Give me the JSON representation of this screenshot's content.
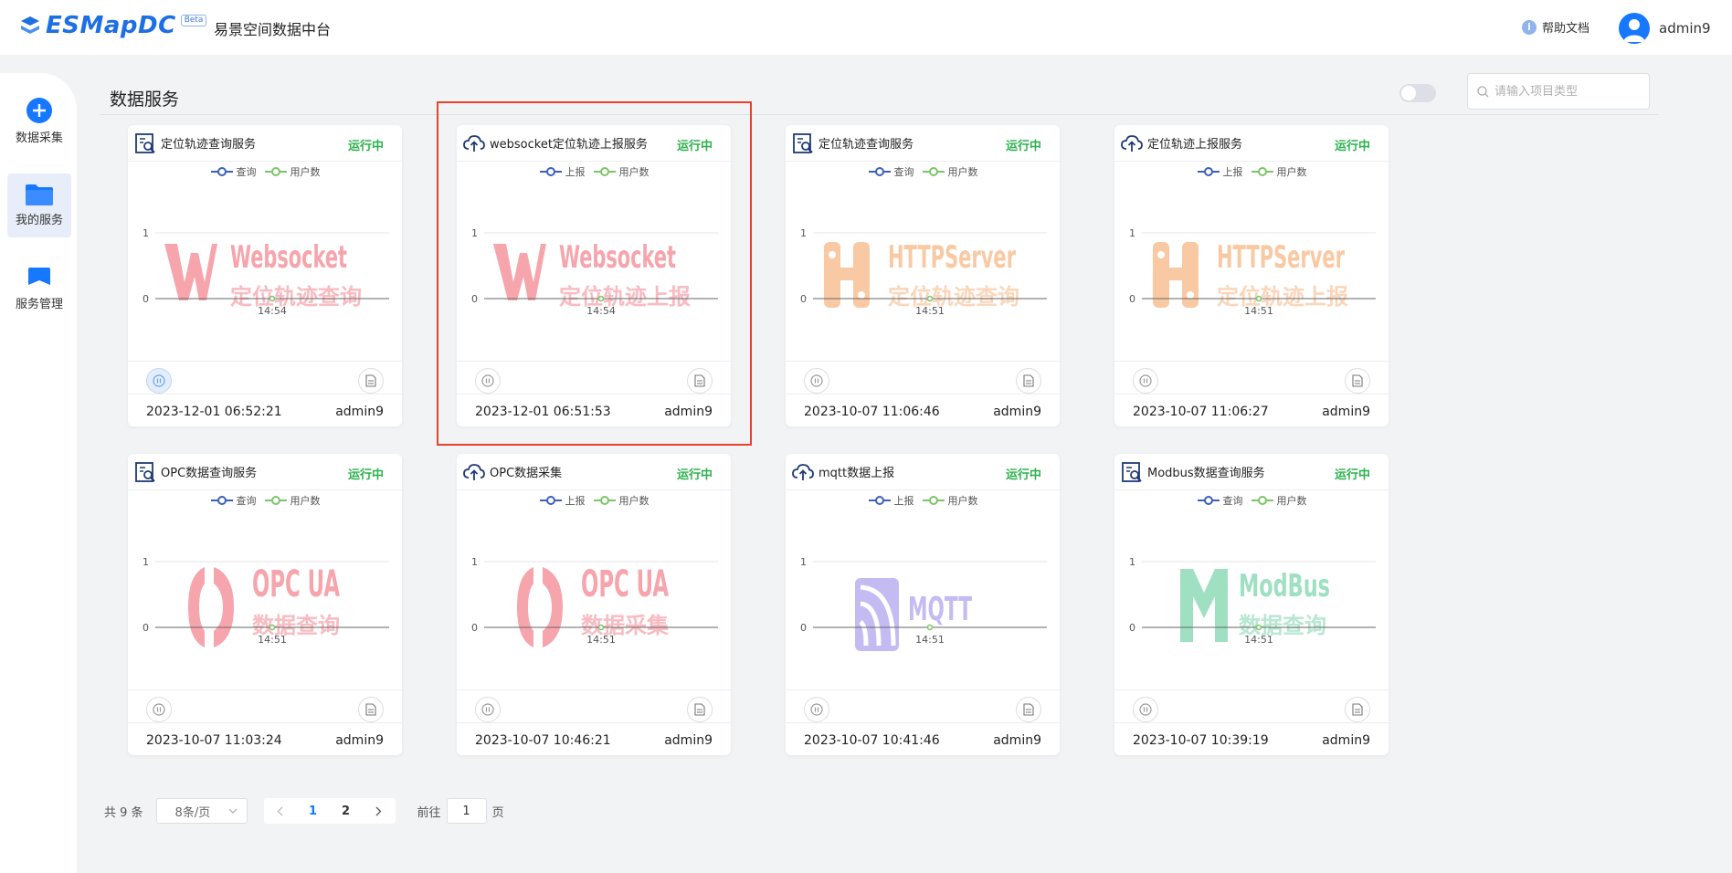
{
  "header": {
    "logo_text": "ESMapDC",
    "beta": "Beta",
    "app_name": "易景空间数据中台",
    "help": "帮助文档",
    "help_icon": "info-icon",
    "user": "admin9"
  },
  "sidebar": {
    "items": [
      {
        "label": "数据采集",
        "icon": "plus-circle-icon",
        "active": false
      },
      {
        "label": "我的服务",
        "icon": "folder-icon",
        "active": true
      },
      {
        "label": "服务管理",
        "icon": "bookmark-icon",
        "active": false
      }
    ]
  },
  "main": {
    "title": "数据服务",
    "search_placeholder": "请输入项目类型"
  },
  "colors": {
    "accent": "#1677ff",
    "running": "#2bb24c",
    "series_a": "#3d5fbd",
    "series_b": "#7cc46a",
    "highlight": "#e8412c"
  },
  "cards": [
    {
      "type": "query",
      "name": "定位轨迹查询服务",
      "status": "运行中",
      "legend_a": "查询",
      "legend_b": "用户数",
      "y_max": "1",
      "y_min": "0",
      "x_label": "14:54",
      "wm_title": "Websocket",
      "wm_sub": "定位轨迹查询",
      "wm_kind": "ws",
      "date": "2023-12-01 06:52:21",
      "user": "admin9",
      "pause_hl": true
    },
    {
      "type": "upload",
      "name": "websocket定位轨迹上报服务",
      "status": "运行中",
      "legend_a": "上报",
      "legend_b": "用户数",
      "y_max": "1",
      "y_min": "0",
      "x_label": "14:54",
      "wm_title": "Websocket",
      "wm_sub": "定位轨迹上报",
      "wm_kind": "ws",
      "date": "2023-12-01 06:51:53",
      "user": "admin9",
      "pause_hl": false
    },
    {
      "type": "query",
      "name": "定位轨迹查询服务",
      "status": "运行中",
      "legend_a": "查询",
      "legend_b": "用户数",
      "y_max": "1",
      "y_min": "0",
      "x_label": "14:51",
      "wm_title": "HTTPServer",
      "wm_sub": "定位轨迹查询",
      "wm_kind": "http",
      "date": "2023-10-07 11:06:46",
      "user": "admin9",
      "pause_hl": false
    },
    {
      "type": "upload",
      "name": "定位轨迹上报服务",
      "status": "运行中",
      "legend_a": "上报",
      "legend_b": "用户数",
      "y_max": "1",
      "y_min": "0",
      "x_label": "14:51",
      "wm_title": "HTTPServer",
      "wm_sub": "定位轨迹上报",
      "wm_kind": "http",
      "date": "2023-10-07 11:06:27",
      "user": "admin9",
      "pause_hl": false
    },
    {
      "type": "query",
      "name": "OPC数据查询服务",
      "status": "运行中",
      "legend_a": "查询",
      "legend_b": "用户数",
      "y_max": "1",
      "y_min": "0",
      "x_label": "14:51",
      "wm_title": "OPC UA",
      "wm_sub": "数据查询",
      "wm_kind": "opc",
      "date": "2023-10-07 11:03:24",
      "user": "admin9",
      "pause_hl": false
    },
    {
      "type": "upload",
      "name": "OPC数据采集",
      "status": "运行中",
      "legend_a": "上报",
      "legend_b": "用户数",
      "y_max": "1",
      "y_min": "0",
      "x_label": "14:51",
      "wm_title": "OPC UA",
      "wm_sub": "数据采集",
      "wm_kind": "opc",
      "date": "2023-10-07 10:46:21",
      "user": "admin9",
      "pause_hl": false
    },
    {
      "type": "upload",
      "name": "mqtt数据上报",
      "status": "运行中",
      "legend_a": "上报",
      "legend_b": "用户数",
      "y_max": "1",
      "y_min": "0",
      "x_label": "14:51",
      "wm_title": "MQTT",
      "wm_sub": "",
      "wm_kind": "mqtt",
      "date": "2023-10-07 10:41:46",
      "user": "admin9",
      "pause_hl": false
    },
    {
      "type": "query",
      "name": "Modbus数据查询服务",
      "status": "运行中",
      "legend_a": "查询",
      "legend_b": "用户数",
      "y_max": "1",
      "y_min": "0",
      "x_label": "14:51",
      "wm_title": "ModBus",
      "wm_sub": "数据查询",
      "wm_kind": "modbus",
      "date": "2023-10-07 10:39:19",
      "user": "admin9",
      "pause_hl": false
    }
  ],
  "pagination": {
    "total": "共 9 条",
    "page_size": "8条/页",
    "pages": [
      "1",
      "2"
    ],
    "current": "1",
    "goto_label": "前往",
    "goto_value": "1",
    "page_suffix": "页"
  }
}
